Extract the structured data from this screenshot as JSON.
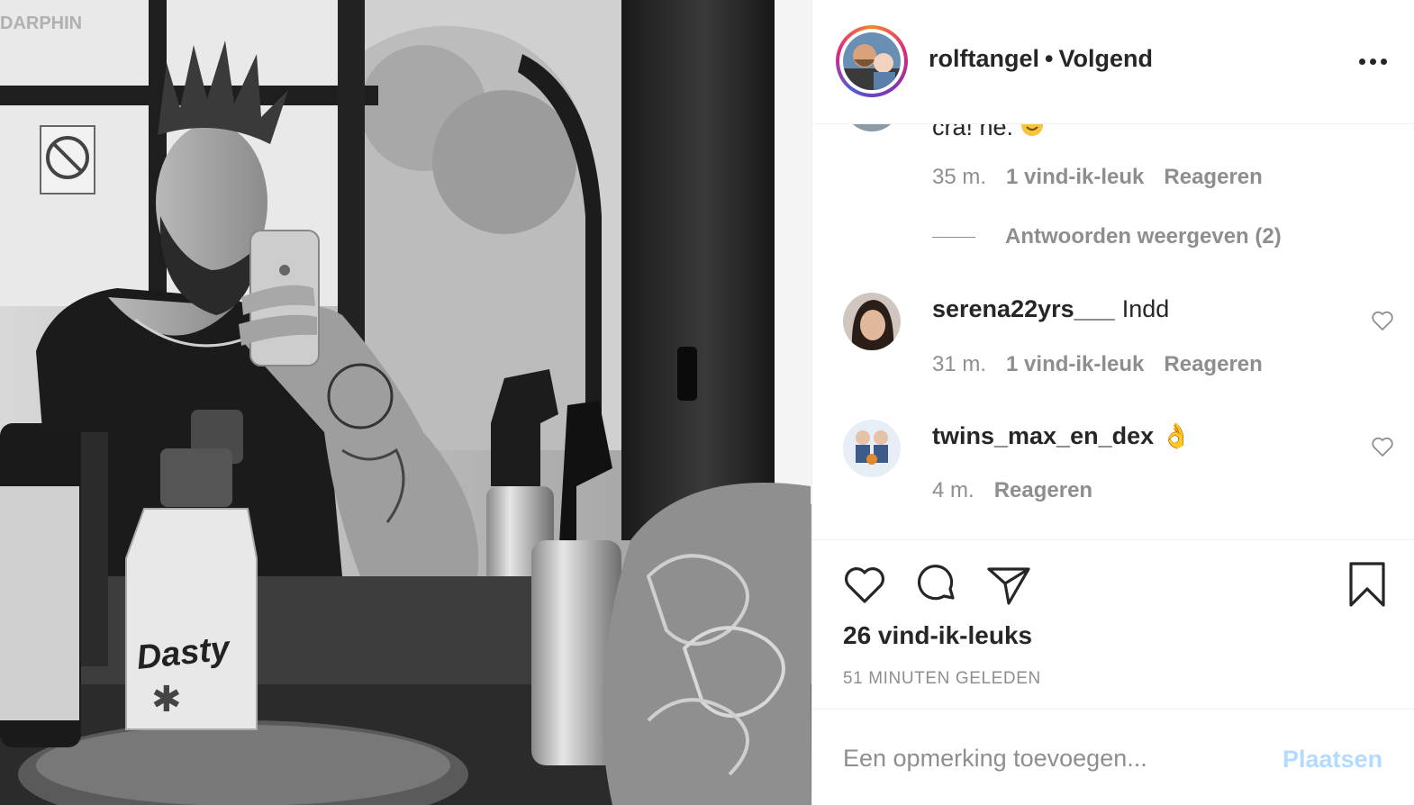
{
  "post": {
    "username": "rolftangel",
    "separator": "•",
    "follow_status": "Volgend",
    "partial_comment_text": "cra! hé.",
    "partial_comment_meta": {
      "time": "35 m.",
      "likes": "1 vind-ik-leuk",
      "reply": "Reageren"
    },
    "view_replies": "Antwoorden weergeven (2)",
    "comments": [
      {
        "username": "serena22yrs___",
        "text": "Indd",
        "time": "31 m.",
        "likes": "1 vind-ik-leuk",
        "reply": "Reageren"
      },
      {
        "username": "twins_max_en_dex",
        "emoji": "👌",
        "time": "4 m.",
        "reply": "Reageren"
      }
    ],
    "likes_count": "26 vind-ik-leuks",
    "posted_time": "51 MINUTEN GELEDEN",
    "add_comment_placeholder": "Een opmerking toevoegen...",
    "post_button": "Plaatsen"
  },
  "photo": {
    "sign_text": "DARPHIN",
    "bottle_label": "Dasty"
  },
  "icons": {
    "header": [
      "more-options-icon"
    ],
    "actions": [
      "heart-icon",
      "comment-icon",
      "share-icon",
      "bookmark-icon"
    ]
  },
  "colors": {
    "link_disabled": "#b3dbff",
    "secondary_text": "#8e8e8e",
    "primary_text": "#262626"
  }
}
